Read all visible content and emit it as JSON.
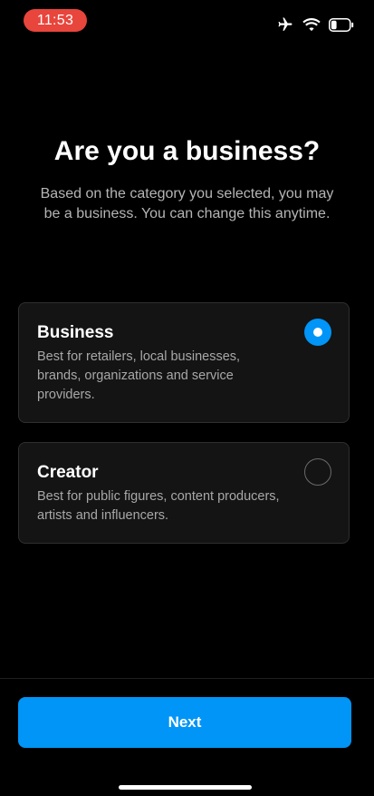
{
  "status_bar": {
    "time": "11:53",
    "time_pill_color": "#e8453c",
    "icons": [
      "airplane-icon",
      "wifi-icon",
      "battery-icon"
    ],
    "battery_level": 0.3
  },
  "header": {
    "title": "Are you a business?",
    "subtitle": "Based on the category you selected, you may be a business. You can change this anytime."
  },
  "options": [
    {
      "title": "Business",
      "description": "Best for retailers, local businesses, brands, organizations and service providers.",
      "selected": true
    },
    {
      "title": "Creator",
      "description": "Best for public figures, content producers, artists and influencers.",
      "selected": false
    }
  ],
  "footer": {
    "next_label": "Next"
  },
  "colors": {
    "accent": "#0095f6",
    "background": "#000000",
    "card_background": "#141414",
    "secondary_text": "#a8a8a8"
  }
}
